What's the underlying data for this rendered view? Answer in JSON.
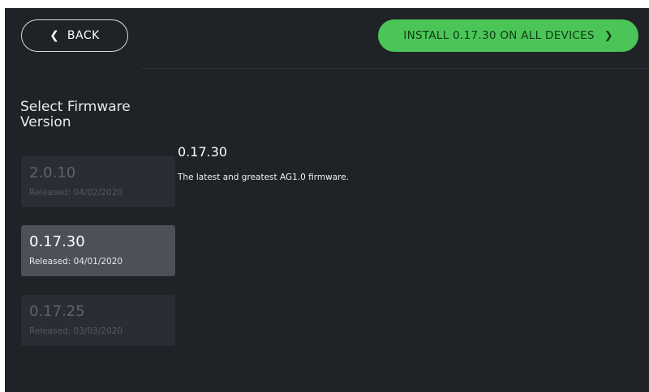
{
  "header": {
    "back_label": "BACK",
    "install_label": "INSTALL 0.17.30 ON ALL DEVICES"
  },
  "sidebar": {
    "title": "Select Firmware Version",
    "versions": [
      {
        "version": "2.0.10",
        "released": "Released: 04/02/2020",
        "selected": false
      },
      {
        "version": "0.17.30",
        "released": "Released: 04/01/2020",
        "selected": true
      },
      {
        "version": "0.17.25",
        "released": "Released: 03/03/2020",
        "selected": false
      }
    ]
  },
  "detail": {
    "version": "0.17.30",
    "description": "The latest and greatest AG1.0 firmware."
  },
  "colors": {
    "background": "#1f2227",
    "accent_green": "#4cc558",
    "selected_card": "#4b5059",
    "unselected_card": "#2a2d33"
  },
  "icons": {
    "back": "chevron-left-icon",
    "install": "chevron-right-icon"
  }
}
